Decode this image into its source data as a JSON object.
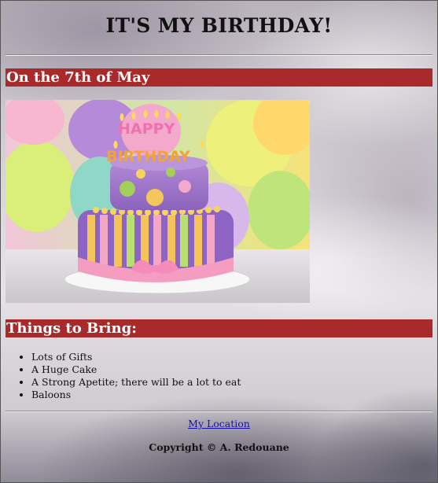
{
  "page": {
    "title": "IT'S MY BIRTHDAY!"
  },
  "date_section": {
    "heading": "On the 7th of May"
  },
  "hero_image": {
    "cake_text_top": "HAPPY",
    "cake_text_bottom": "BIRTHDAY",
    "accent_color": "#a82a2a"
  },
  "things_section": {
    "heading": "Things to Bring:",
    "items": [
      "Lots of Gifts",
      "A Huge Cake",
      "A Strong Apetite; there will be a lot to eat",
      "Baloons"
    ]
  },
  "footer": {
    "location_link": "My Location",
    "copyright": "Copyright © A. Redouane"
  }
}
